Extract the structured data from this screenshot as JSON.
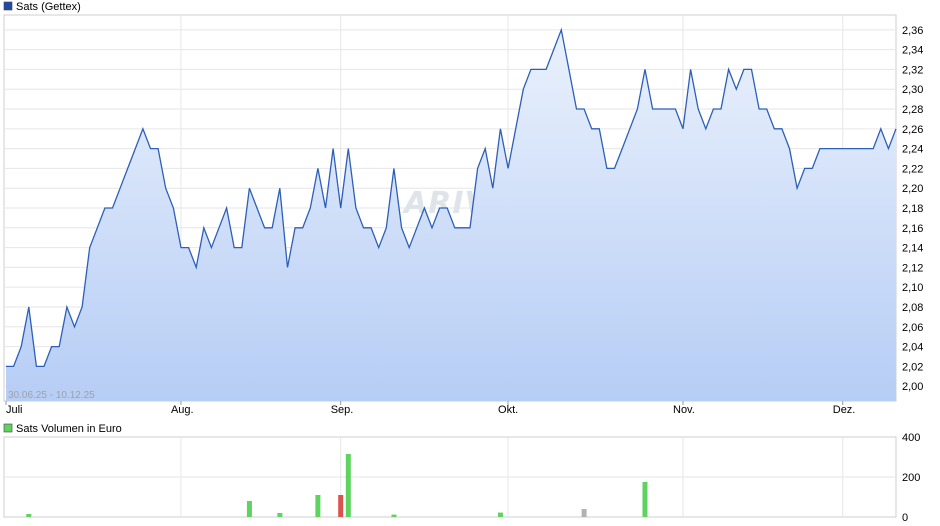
{
  "chart_data": [
    {
      "type": "area",
      "legend": "Sats (Gettex)",
      "legend_color": "#1f4aa8",
      "line_color": "#2c5fb8",
      "fill_top_color": "#eaf1fc",
      "fill_bottom_color": "#b6cdf5",
      "date_range": "30.06.25 - 10.12.25",
      "watermark": "ARIVA.DE",
      "ylim": [
        1.985,
        2.375
      ],
      "yticks": [
        "2,00",
        "2,02",
        "2,04",
        "2,06",
        "2,08",
        "2,10",
        "2,12",
        "2,14",
        "2,16",
        "2,18",
        "2,20",
        "2,22",
        "2,24",
        "2,26",
        "2,28",
        "2,30",
        "2,32",
        "2,34",
        "2,36"
      ],
      "ytick_values": [
        2.0,
        2.02,
        2.04,
        2.06,
        2.08,
        2.1,
        2.12,
        2.14,
        2.16,
        2.18,
        2.2,
        2.22,
        2.24,
        2.26,
        2.28,
        2.3,
        2.32,
        2.34,
        2.36
      ],
      "x_labels": [
        "Juli",
        "Aug.",
        "Sep.",
        "Okt.",
        "Nov.",
        "Dez."
      ],
      "x_label_positions": [
        0,
        23,
        44,
        66,
        89,
        110
      ],
      "values": [
        2.02,
        2.02,
        2.04,
        2.08,
        2.02,
        2.02,
        2.04,
        2.04,
        2.08,
        2.06,
        2.08,
        2.14,
        2.16,
        2.18,
        2.18,
        2.2,
        2.22,
        2.24,
        2.26,
        2.24,
        2.24,
        2.2,
        2.18,
        2.14,
        2.14,
        2.12,
        2.16,
        2.14,
        2.16,
        2.18,
        2.14,
        2.14,
        2.2,
        2.18,
        2.16,
        2.16,
        2.2,
        2.12,
        2.16,
        2.16,
        2.18,
        2.22,
        2.18,
        2.24,
        2.18,
        2.24,
        2.18,
        2.16,
        2.16,
        2.14,
        2.16,
        2.22,
        2.16,
        2.14,
        2.16,
        2.18,
        2.16,
        2.18,
        2.18,
        2.16,
        2.16,
        2.16,
        2.22,
        2.24,
        2.2,
        2.26,
        2.22,
        2.26,
        2.3,
        2.32,
        2.32,
        2.32,
        2.34,
        2.36,
        2.32,
        2.28,
        2.28,
        2.26,
        2.26,
        2.22,
        2.22,
        2.24,
        2.26,
        2.28,
        2.32,
        2.28,
        2.28,
        2.28,
        2.28,
        2.26,
        2.32,
        2.28,
        2.26,
        2.28,
        2.28,
        2.32,
        2.3,
        2.32,
        2.32,
        2.28,
        2.28,
        2.26,
        2.26,
        2.24,
        2.2,
        2.22,
        2.22,
        2.24,
        2.24,
        2.24,
        2.24,
        2.24,
        2.24,
        2.24,
        2.24,
        2.26,
        2.24,
        2.26
      ]
    },
    {
      "type": "bar",
      "legend": "Sats Volumen in Euro",
      "legend_color": "#5fd35f",
      "ylim": [
        0,
        400
      ],
      "yticks": [
        "0",
        "200",
        "400"
      ],
      "ytick_values": [
        0,
        200,
        400
      ],
      "bars": [
        {
          "i": 3,
          "value": 15,
          "color": "#5fd35f"
        },
        {
          "i": 32,
          "value": 80,
          "color": "#5fd35f"
        },
        {
          "i": 36,
          "value": 20,
          "color": "#5fd35f"
        },
        {
          "i": 41,
          "value": 110,
          "color": "#5fd35f"
        },
        {
          "i": 44,
          "value": 110,
          "color": "#d9534f"
        },
        {
          "i": 45,
          "value": 315,
          "color": "#5fd35f"
        },
        {
          "i": 51,
          "value": 12,
          "color": "#5fd35f"
        },
        {
          "i": 65,
          "value": 22,
          "color": "#5fd35f"
        },
        {
          "i": 76,
          "value": 40,
          "color": "#b3b3b3"
        },
        {
          "i": 84,
          "value": 175,
          "color": "#5fd35f"
        }
      ]
    }
  ]
}
